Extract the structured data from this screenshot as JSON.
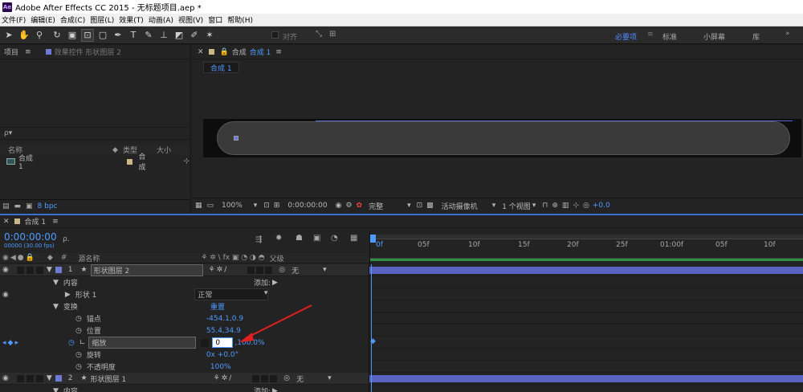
{
  "window": {
    "title": "Adobe After Effects CC 2015 - 无标题项目.aep *",
    "logo_text": "Ae"
  },
  "menu": [
    "文件(F)",
    "编辑(E)",
    "合成(C)",
    "图层(L)",
    "效果(T)",
    "动画(A)",
    "视图(V)",
    "窗口",
    "帮助(H)"
  ],
  "toolbar": {
    "snap_label": "对齐",
    "workspaces": [
      "必要项",
      "标准",
      "小屏幕",
      "库"
    ],
    "active_workspace": "必要项"
  },
  "project_panel": {
    "tab_label": "项目",
    "effects_tab_label": "效果控件 形状图层 2",
    "search_placeholder": "ρ▾",
    "columns": [
      "名称",
      "类型",
      "大小"
    ],
    "items": [
      {
        "name": "合成 1",
        "type": "合成"
      }
    ],
    "bpc_label": "8 bpc"
  },
  "comp_panel": {
    "tab_label": "合成",
    "tab_name": "合成 1",
    "sub_tab": "合成 1",
    "zoom": "100%",
    "timecode": "0:00:00:00",
    "quality": "完整",
    "camera": "活动摄像机",
    "views": "1 个视图",
    "exposure": "+0.0"
  },
  "timeline": {
    "tab_label": "合成 1",
    "timecode": "0:00:00:00",
    "fps": "00000 (30.00 fps)",
    "search_placeholder": "ρ.",
    "col_source_name": "源名称",
    "col_parent": "父级",
    "ruler_ticks": [
      "0f",
      "05f",
      "10f",
      "15f",
      "20f",
      "25f",
      "01:00f",
      "05f",
      "10f",
      "15f"
    ],
    "layer1": {
      "num": "1",
      "name": "形状图层 2",
      "parent": "无"
    },
    "layer2": {
      "num": "2",
      "name": "形状图层 1",
      "parent": "无"
    },
    "contents_label": "内容",
    "add_label": "添加:",
    "shape_label": "形状 1",
    "blend_mode": "正常",
    "transform_label": "变换",
    "reset_label": "重置",
    "anchor_label": "锚点",
    "anchor_value": "-454.1,0.9",
    "position_label": "位置",
    "position_value": "55.4,34.9",
    "scale_label": "缩放",
    "scale_input": "0",
    "scale_value": ",100.0%",
    "rotation_label": "旋转",
    "rotation_value": "0x +0.0°",
    "opacity_label": "不透明度",
    "opacity_value": "100%",
    "contents2_label": "内容",
    "add2_label": "添加:"
  },
  "colors": {
    "accent": "#4d9bff",
    "layer_label": "#6f7ad6",
    "annotation_arrow": "#e02020"
  }
}
